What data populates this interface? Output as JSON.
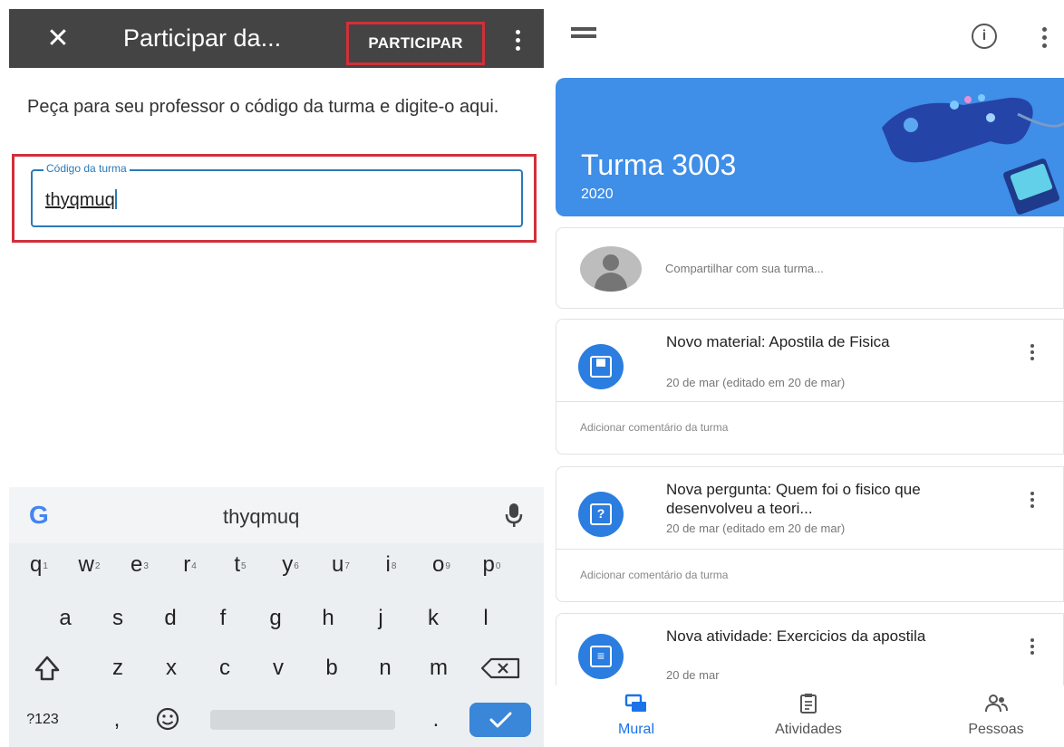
{
  "join_screen": {
    "close_icon": "close-icon",
    "title": "Participar da...",
    "join_label": "PARTICIPAR",
    "instruction": "Peça para seu professor o código da turma e digite-o aqui.",
    "code_field": {
      "label": "Código da turma",
      "value": "thyqmuq"
    }
  },
  "keyboard": {
    "suggestion": "thyqmuq",
    "row1": [
      {
        "k": "q",
        "n": "1"
      },
      {
        "k": "w",
        "n": "2"
      },
      {
        "k": "e",
        "n": "3"
      },
      {
        "k": "r",
        "n": "4"
      },
      {
        "k": "t",
        "n": "5"
      },
      {
        "k": "y",
        "n": "6"
      },
      {
        "k": "u",
        "n": "7"
      },
      {
        "k": "i",
        "n": "8"
      },
      {
        "k": "o",
        "n": "9"
      },
      {
        "k": "p",
        "n": "0"
      }
    ],
    "row2": [
      "a",
      "s",
      "d",
      "f",
      "g",
      "h",
      "j",
      "k",
      "l"
    ],
    "row3": [
      "z",
      "x",
      "c",
      "v",
      "b",
      "n",
      "m"
    ],
    "symbols_label": "?123",
    "comma": ",",
    "period": "."
  },
  "class_screen": {
    "class_name": "Turma 3003",
    "class_year": "2020",
    "share_placeholder": "Compartilhar com sua turma...",
    "posts": [
      {
        "icon": "material-icon",
        "title": "Novo material: Apostila de Fisica",
        "date": "20 de mar (editado em 20 de mar)",
        "comment": "Adicionar comentário da turma"
      },
      {
        "icon": "question-icon",
        "title": "Nova pergunta: Quem foi o fisico que desenvolveu a teori...",
        "date": "20 de mar (editado em 20 de mar)",
        "comment": "Adicionar comentário da turma"
      },
      {
        "icon": "assignment-icon",
        "title": "Nova atividade: Exercicios da apostila",
        "date": "20 de mar"
      }
    ],
    "nav": [
      {
        "label": "Mural",
        "active": true
      },
      {
        "label": "Atividades",
        "active": false
      },
      {
        "label": "Pessoas",
        "active": false
      }
    ],
    "accent_color": "#3f8ee7",
    "active_nav_color": "#1a73e8"
  }
}
